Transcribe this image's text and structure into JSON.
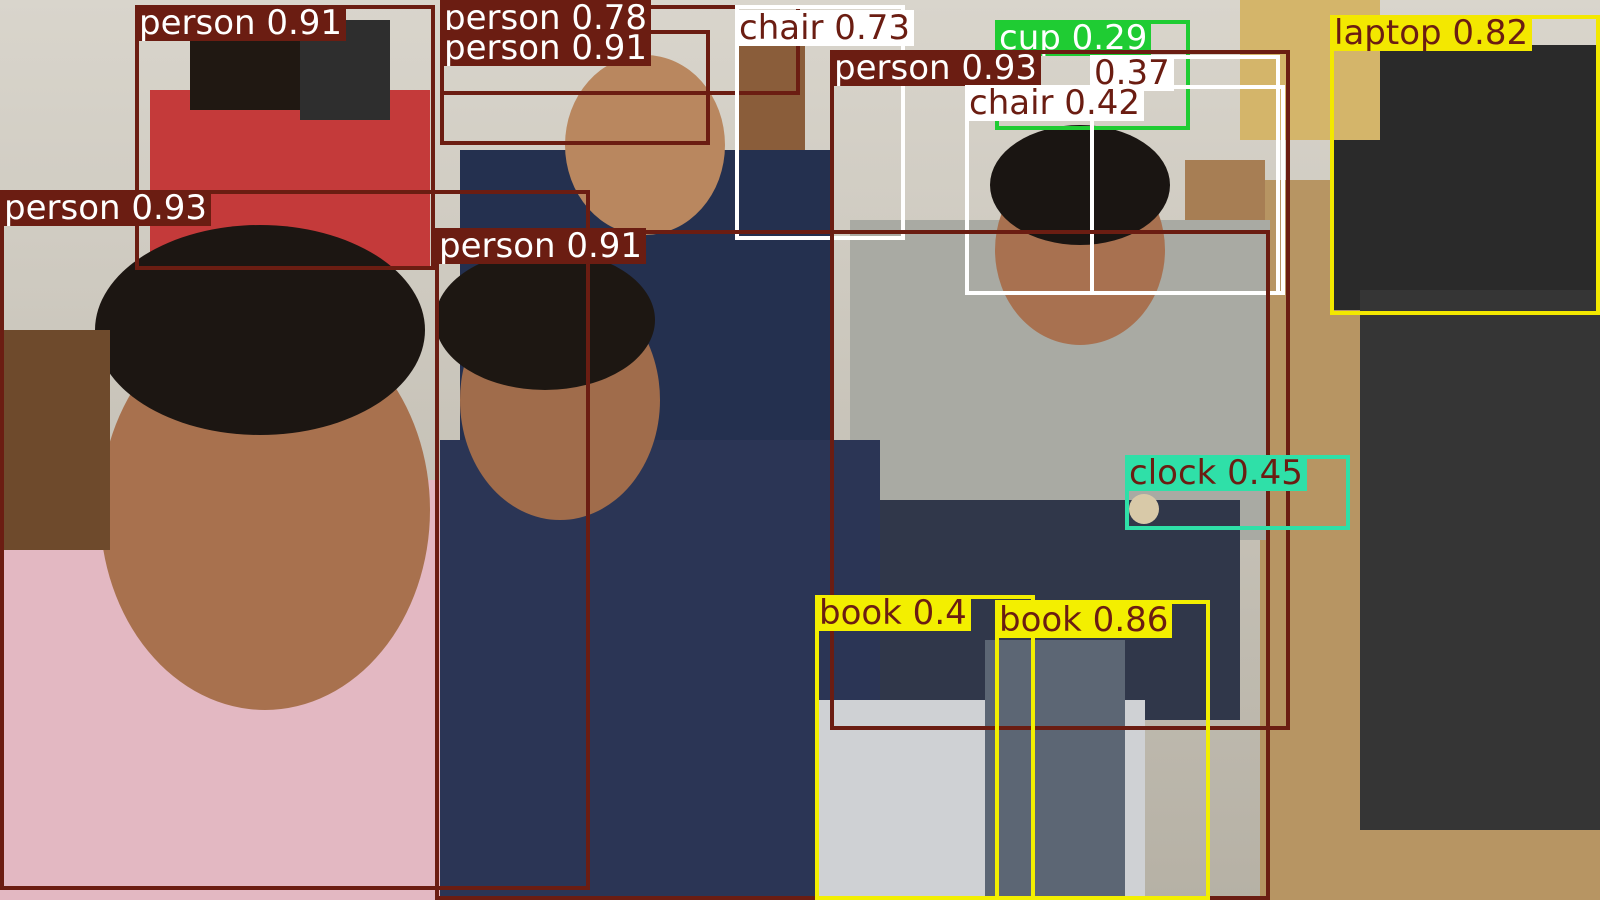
{
  "colors": {
    "person": "#6b1d12",
    "chair": "#ffffff",
    "cup": "#1fcc33",
    "book": "#f3ef00",
    "laptop": "#f3e800",
    "clock": "#2fe0a8"
  },
  "label_text_colors": {
    "person": "#ffffff",
    "chair": "#6b1d12",
    "cup": "#ffffff",
    "book": "#6b1d12",
    "laptop": "#6b1d12",
    "clock": "#6b1d12"
  },
  "detections": [
    {
      "label": "person 0.91",
      "class": "person"
    },
    {
      "label": "person 0.78",
      "class": "person"
    },
    {
      "label": "person 0.91",
      "class": "person"
    },
    {
      "label": "chair 0.73",
      "class": "chair"
    },
    {
      "label": "cup 0.29",
      "class": "cup"
    },
    {
      "label": "person 0.93",
      "class": "person"
    },
    {
      "label": "0.37",
      "class": "chair"
    },
    {
      "label": "chair 0.42",
      "class": "chair"
    },
    {
      "label": "laptop 0.82",
      "class": "laptop"
    },
    {
      "label": "person 0.93",
      "class": "person"
    },
    {
      "label": "person 0.91",
      "class": "person"
    },
    {
      "label": "clock 0.45",
      "class": "clock"
    },
    {
      "label": "book 0.4",
      "class": "book"
    },
    {
      "label": "book 0.86",
      "class": "book"
    }
  ]
}
